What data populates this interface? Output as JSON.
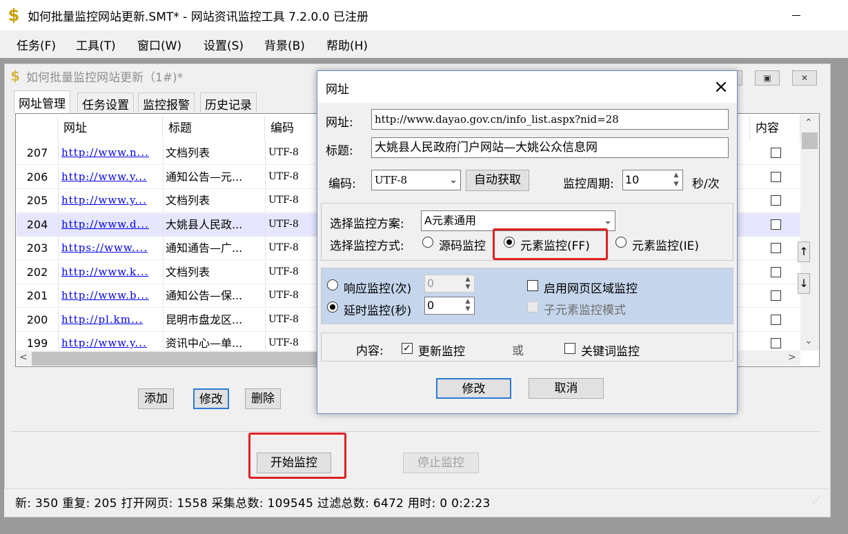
{
  "window": {
    "title": "如何批量监控网站更新.SMT* - 网站资讯监控工具 7.2.0.0 已注册",
    "icon": "dollar-app-icon"
  },
  "menu": [
    "任务(F)",
    "工具(T)",
    "窗口(W)",
    "设置(S)",
    "背景(B)",
    "帮助(H)"
  ],
  "child": {
    "title": "如何批量监控网站更新（1#)*"
  },
  "tabs": [
    "网址管理",
    "任务设置",
    "监控报警",
    "历史记录"
  ],
  "grid": {
    "headers": [
      "网址",
      "标题",
      "编码",
      "内容"
    ],
    "rows": [
      {
        "id": "207",
        "url": "http://www.n...",
        "title": "文档列表",
        "enc": "UTF-8"
      },
      {
        "id": "206",
        "url": "http://www.y...",
        "title": "通知公告—元...",
        "enc": "UTF-8"
      },
      {
        "id": "205",
        "url": "http://www.y...",
        "title": "文档列表",
        "enc": "UTF-8"
      },
      {
        "id": "204",
        "url": "http://www.d...",
        "title": "大姚县人民政...",
        "enc": "UTF-8"
      },
      {
        "id": "203",
        "url": "https://www....",
        "title": "通知通告—广...",
        "enc": "UTF-8"
      },
      {
        "id": "202",
        "url": "http://www.k...",
        "title": "文档列表",
        "enc": "UTF-8"
      },
      {
        "id": "201",
        "url": "http://www.b...",
        "title": "通知公告—保...",
        "enc": "UTF-8"
      },
      {
        "id": "200",
        "url": "http://pl.km...",
        "title": "昆明市盘龙区...",
        "enc": "UTF-8"
      },
      {
        "id": "199",
        "url": "http://www.y...",
        "title": "资讯中心—单...",
        "enc": "UTF-8"
      }
    ],
    "selected_id": "204",
    "side_up": "↑",
    "side_down": "↓"
  },
  "actions": {
    "add": "添加",
    "modify": "修改",
    "delete": "删除",
    "start": "开始监控",
    "stop": "停止监控"
  },
  "status": "新: 350  重复: 205  打开网页: 1558  采集总数: 109545  过滤总数: 6472  用时:  0 0:2:23",
  "dialog": {
    "title": "网址",
    "url_label": "网址:",
    "url_value": "http://www.dayao.gov.cn/info_list.aspx?nid=28",
    "title_label": "标题:",
    "title_value": "大姚县人民政府门户网站—大姚公众信息网",
    "encoding_label": "编码:",
    "encoding_value": "UTF-8",
    "auto_detect": "自动获取",
    "period_label": "监控周期:",
    "period_value": "10",
    "period_unit": "秒/次",
    "scheme_label": "选择监控方案:",
    "scheme_value": "A元素通用",
    "method_label": "选择监控方式:",
    "method_options": [
      "源码监控",
      "元素监控(FF)",
      "元素监控(IE)"
    ],
    "method_selected": "元素监控(FF)",
    "response_monitor": "响应监控(次)",
    "response_value": "0",
    "delay_monitor": "延时监控(秒)",
    "delay_value": "0",
    "region_monitor": "启用网页区域监控",
    "child_mode": "子元素监控模式",
    "content_label": "内容:",
    "update_monitor": "更新监控",
    "or": "或",
    "keyword_monitor": "关键词监控",
    "ok": "修改",
    "cancel": "取消"
  }
}
